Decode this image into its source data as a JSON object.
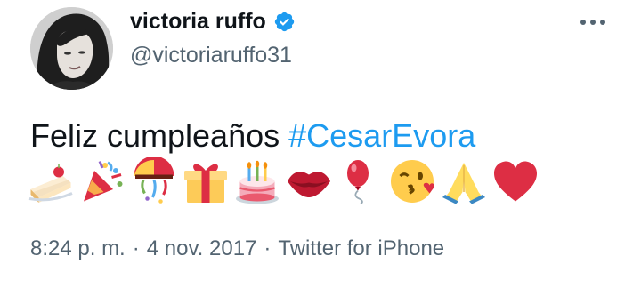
{
  "user": {
    "display_name": "victoria ruffo",
    "handle": "@victoriaruffo31",
    "verified_icon": "verified-badge-icon",
    "badge_color": "#1d9bf0"
  },
  "tweet": {
    "text_prefix": "Feliz cumpleaños ",
    "hashtag": "#CesarEvora",
    "emojis": [
      "cake-icon",
      "party-popper-icon",
      "confetti-ball-icon",
      "gift-icon",
      "birthday-cake-icon",
      "lips-icon",
      "balloon-icon",
      "kissing-face-icon",
      "folded-hands-icon",
      "heart-icon"
    ]
  },
  "meta": {
    "time": "8:24 p. m.",
    "sep1": "·",
    "date": "4 nov. 2017",
    "sep2": "·",
    "source": "Twitter for iPhone"
  },
  "colors": {
    "text": "#0f1419",
    "secondary": "#536471",
    "link": "#1d9bf0"
  }
}
